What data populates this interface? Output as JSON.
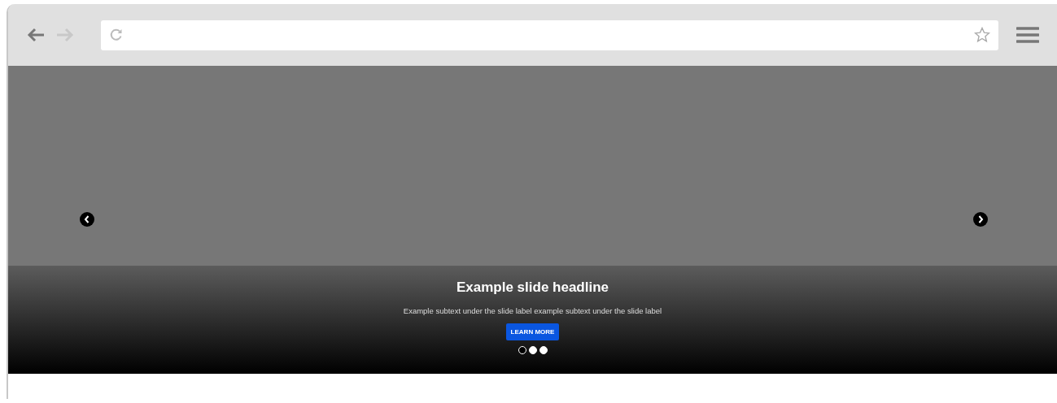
{
  "browser": {
    "back_enabled": true,
    "forward_enabled": false
  },
  "carousel": {
    "headline": "Example slide headline",
    "subtext": "Example subtext under the slide label example subtext under the slide label",
    "button": "LEARN MORE",
    "indicators": [
      {
        "selected": true
      },
      {
        "selected": false
      },
      {
        "selected": false
      }
    ]
  }
}
